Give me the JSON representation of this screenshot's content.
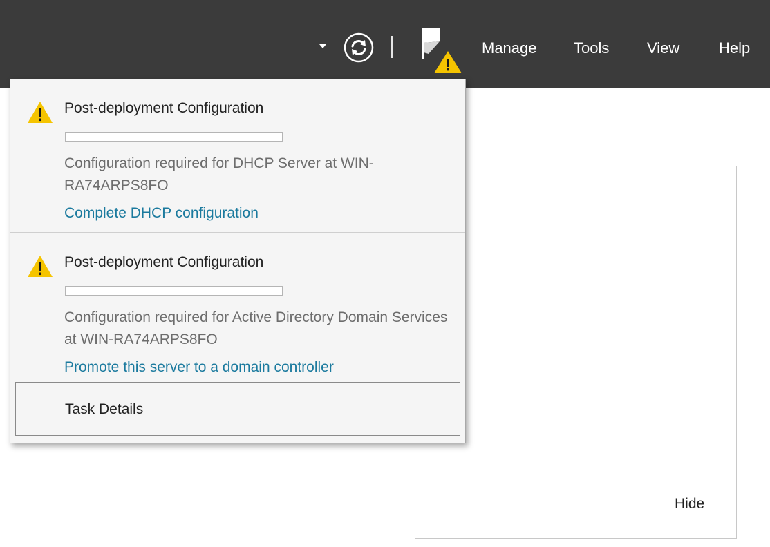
{
  "menu": {
    "manage": "Manage",
    "tools": "Tools",
    "view": "View",
    "help": "Help"
  },
  "icons": {
    "dropdown": "chevron-down-icon",
    "refresh": "refresh-icon",
    "notifications": "flag-warning-icon",
    "warning": "warning-icon"
  },
  "colors": {
    "topbar": "#3b3b3b",
    "link": "#1b7a9e",
    "warning": "#f5c400",
    "popup_bg": "#f5f5f5"
  },
  "notifications": [
    {
      "title": "Post-deployment Configuration",
      "progress": 0,
      "description": "Configuration required for DHCP Server at WIN-RA74ARPS8FO",
      "link": "Complete DHCP configuration"
    },
    {
      "title": "Post-deployment Configuration",
      "progress": 0,
      "description": "Configuration required for Active Directory Domain Services at WIN-RA74ARPS8FO",
      "link": "Promote this server to a domain controller"
    }
  ],
  "task_details": "Task Details",
  "hide": "Hide"
}
